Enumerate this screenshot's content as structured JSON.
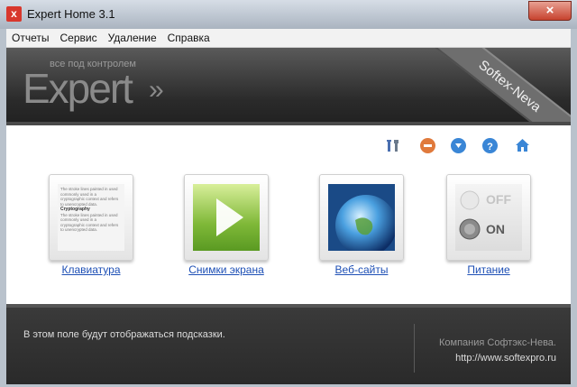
{
  "window": {
    "title": "Expert Home 3.1",
    "close_glyph": "×"
  },
  "menu": {
    "items": [
      "Отчеты",
      "Сервис",
      "Удаление",
      "Справка"
    ]
  },
  "header": {
    "tagline": "все под контролем",
    "logo": "Expert",
    "logo_arrows": "»",
    "ribbon": "Softex-Neva"
  },
  "toolbar": {
    "icons": [
      "tools-icon",
      "minus-icon",
      "download-icon",
      "help-icon",
      "home-icon"
    ],
    "colors": {
      "minus": "#e07a3c",
      "download": "#3a86d6",
      "help": "#3a86d6",
      "home": "#3a86d6"
    }
  },
  "tiles": [
    {
      "label": "Клавиатура",
      "icon": "document-icon"
    },
    {
      "label": "Снимки экрана",
      "icon": "play-icon"
    },
    {
      "label": "Веб-сайты",
      "icon": "globe-icon"
    },
    {
      "label": "Питание",
      "icon": "power-switch-icon"
    }
  ],
  "keyboard_preview": {
    "heading": "Cryptography",
    "body": "The stroke lines painted in used commonly used in a cryptographic context and refers to unencrypted data."
  },
  "power_switch": {
    "off": "OFF",
    "on": "ON"
  },
  "footer": {
    "hint": "В этом поле будут отображаться подсказки.",
    "company": "Компания Софтэкс-Нева.",
    "site": "http://www.softexpro.ru"
  }
}
